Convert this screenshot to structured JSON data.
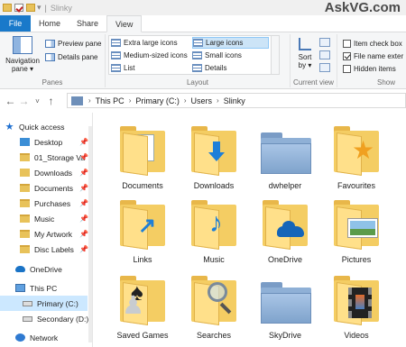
{
  "window": {
    "title": "Slinky",
    "watermark": "AskVG.com"
  },
  "ribbon_tabs": [
    "File",
    "Home",
    "Share",
    "View"
  ],
  "ribbon": {
    "panes": {
      "nav_pane_label_1": "Navigation",
      "nav_pane_label_2": "pane",
      "preview_pane": "Preview pane",
      "details_pane": "Details pane",
      "group_label": "Panes"
    },
    "layout": {
      "extra_large_icons": "Extra large icons",
      "large_icons": "Large icons",
      "medium_icons": "Medium-sized icons",
      "small_icons": "Small icons",
      "list": "List",
      "details": "Details",
      "group_label": "Layout"
    },
    "current_view": {
      "sort_by_1": "Sort",
      "sort_by_2": "by",
      "group_label": "Current view"
    },
    "show_hide": {
      "item_check_boxes": "Item check box",
      "item_check_boxes_checked": false,
      "file_name_extensions": "File name exter",
      "file_name_extensions_checked": true,
      "hidden_items": "Hidden items",
      "hidden_items_checked": false,
      "group_label": "Show"
    }
  },
  "address": {
    "crumbs": [
      "This PC",
      "Primary (C:)",
      "Users",
      "Slinky"
    ]
  },
  "nav": {
    "quick_access": "Quick access",
    "pinned": [
      "Desktop",
      "01_Storage Va",
      "Downloads",
      "Documents",
      "Purchases",
      "Music",
      "My Artwork",
      "Disc Labels"
    ],
    "onedrive": "OneDrive",
    "this_pc": "This PC",
    "primary": "Primary (C:)",
    "secondary": "Secondary (D:)",
    "network": "Network"
  },
  "items": [
    "Documents",
    "Downloads",
    "dwhelper",
    "Favourites",
    "Links",
    "Music",
    "OneDrive",
    "Pictures",
    "Saved Games",
    "Searches",
    "SkyDrive",
    "Videos"
  ],
  "colors": {
    "accent": "#1979ca",
    "folder": "#f4cd63",
    "selection": "#cce8ff"
  }
}
